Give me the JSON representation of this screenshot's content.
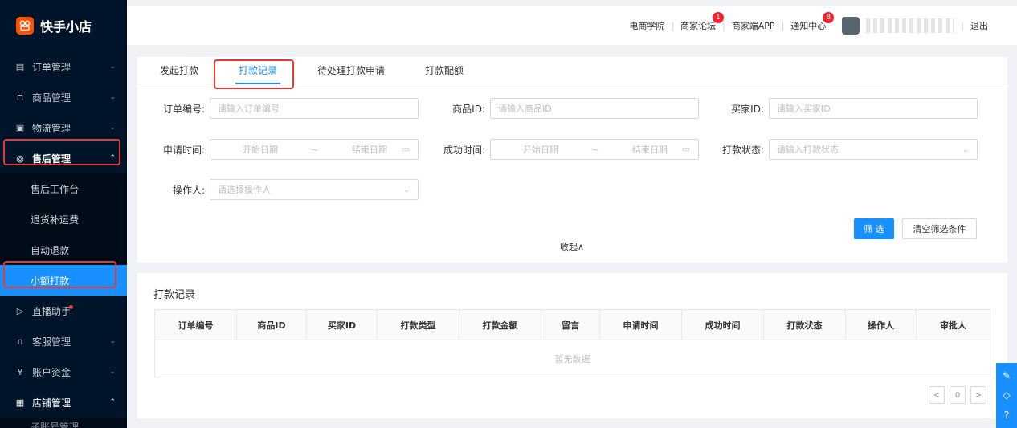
{
  "app": {
    "logo_text": "快手小店"
  },
  "sidebar": {
    "items": [
      {
        "label": "订单管理",
        "icon": "order-icon",
        "glyph": "▤",
        "arrow": "⌄"
      },
      {
        "label": "商品管理",
        "icon": "bag-icon",
        "glyph": "⊓",
        "arrow": "⌄"
      },
      {
        "label": "物流管理",
        "icon": "truck-icon",
        "glyph": "▣",
        "arrow": "⌄"
      },
      {
        "label": "售后管理",
        "icon": "shield-icon",
        "glyph": "◎",
        "arrow": "⌃"
      },
      {
        "label": "直播助手",
        "icon": "live-icon",
        "glyph": "▷",
        "arrow": ""
      },
      {
        "label": "客服管理",
        "icon": "headset-icon",
        "glyph": "∩",
        "arrow": "⌄"
      },
      {
        "label": "账户资金",
        "icon": "money-icon",
        "glyph": "¥",
        "arrow": "⌄"
      },
      {
        "label": "店铺管理",
        "icon": "store-icon",
        "glyph": "▦",
        "arrow": "⌃"
      }
    ],
    "sub_items": [
      "售后工作台",
      "退货补运费",
      "自动退款",
      "小额打款"
    ],
    "bottom_partial": "子账号管理"
  },
  "topbar": {
    "links": [
      "电商学院",
      "商家论坛",
      "商家端APP",
      "通知中心"
    ],
    "forum_badge": "1",
    "notice_badge": "8",
    "logout": "退出"
  },
  "tabs": [
    "发起打款",
    "打款记录",
    "待处理打款申请",
    "打款配额"
  ],
  "filters": {
    "order_no": {
      "label": "订单编号:",
      "placeholder": "请输入订单编号"
    },
    "product_id": {
      "label": "商品ID:",
      "placeholder": "请输入商品ID"
    },
    "buyer_id": {
      "label": "买家ID:",
      "placeholder": "请输入买家ID"
    },
    "apply_time": {
      "label": "申请时间:",
      "start": "开始日期",
      "sep": "~",
      "end": "结束日期"
    },
    "success_time": {
      "label": "成功时间:",
      "start": "开始日期",
      "sep": "~",
      "end": "结束日期"
    },
    "status": {
      "label": "打款状态:",
      "placeholder": "请输入打款状态"
    },
    "operator": {
      "label": "操作人:",
      "placeholder": "请选择操作人"
    }
  },
  "buttons": {
    "filter": "筛 选",
    "clear": "清空筛选条件",
    "collapse": "收起∧"
  },
  "records": {
    "title": "打款记录",
    "columns": [
      "订单编号",
      "商品ID",
      "买家ID",
      "打款类型",
      "打款金额",
      "留言",
      "申请时间",
      "成功时间",
      "打款状态",
      "操作人",
      "审批人"
    ],
    "empty_text": "暂无数据"
  },
  "pager": {
    "prev": "<",
    "page": "0",
    "next": ">"
  },
  "colors": {
    "primary": "#1890ff",
    "sidebar_bg": "#001529",
    "highlight_box": "#e53935"
  }
}
